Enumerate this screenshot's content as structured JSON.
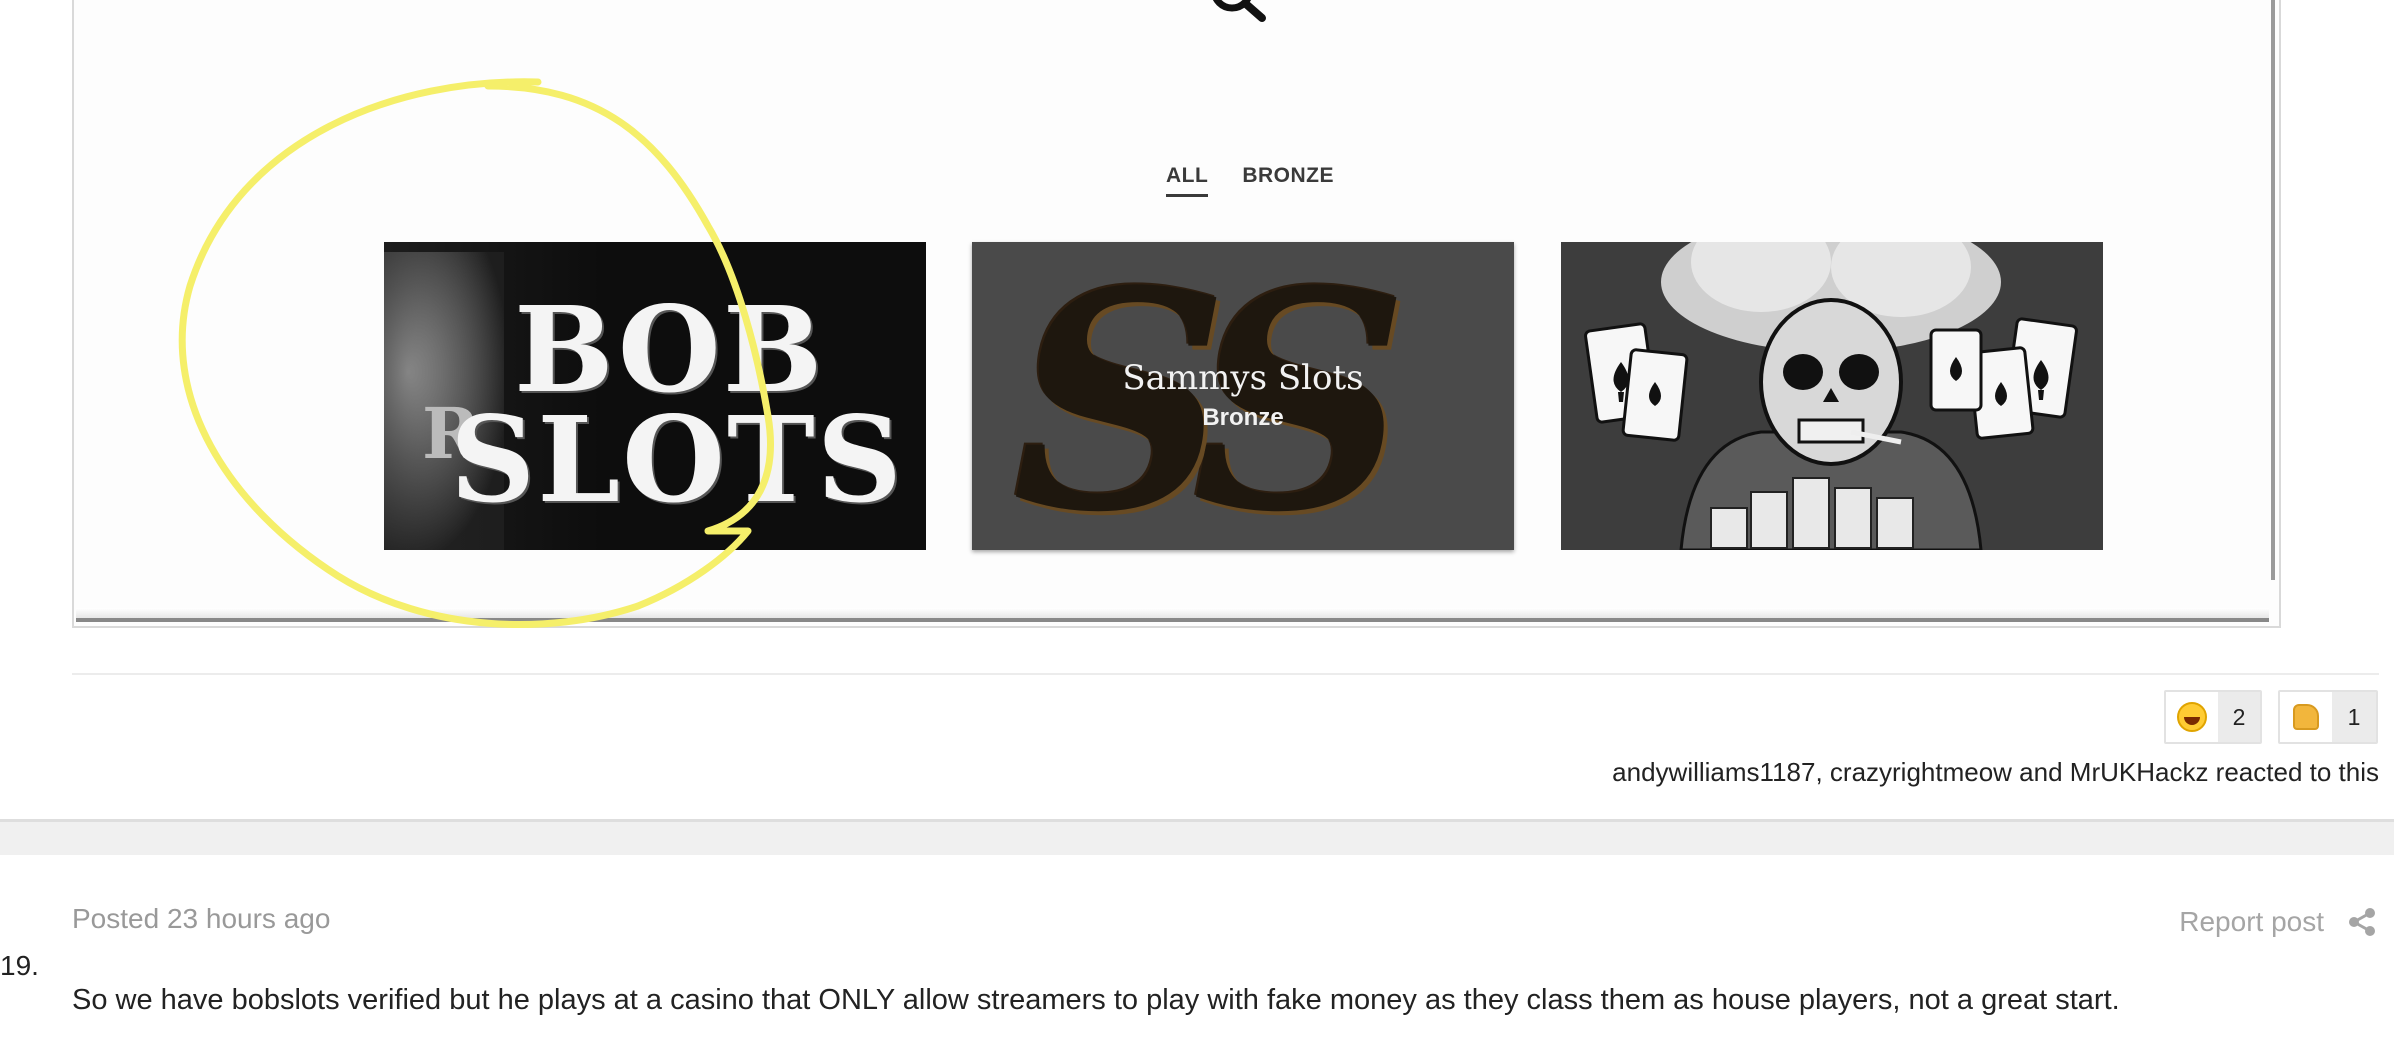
{
  "embed": {
    "filters": [
      {
        "label": "ALL",
        "active": true
      },
      {
        "label": "BRONZE",
        "active": false
      }
    ],
    "cards": [
      {
        "name": "Bob Slots",
        "logo_line1": "BOB",
        "logo_line2": "SLOTS",
        "logo_letter": "R"
      },
      {
        "name": "Sammys Slots",
        "tier": "Bronze",
        "monogram": "SS"
      },
      {
        "name": "poker-skull-artwork"
      }
    ],
    "annotation_color": "#f5ef6a"
  },
  "reactions": [
    {
      "icon": "laughing-emoji-icon",
      "count": "2"
    },
    {
      "icon": "thumbs-up-icon",
      "count": "1"
    }
  ],
  "reacted_text": "andywilliams1187, crazyrightmeow and MrUKHackz reacted to this",
  "post": {
    "posted": "Posted 23 hours ago",
    "report": "Report post",
    "number": "19.",
    "body": "So we have bobslots verified but he plays at a casino that ONLY allow streamers to play with fake money as they class them as house players, not a great start."
  }
}
